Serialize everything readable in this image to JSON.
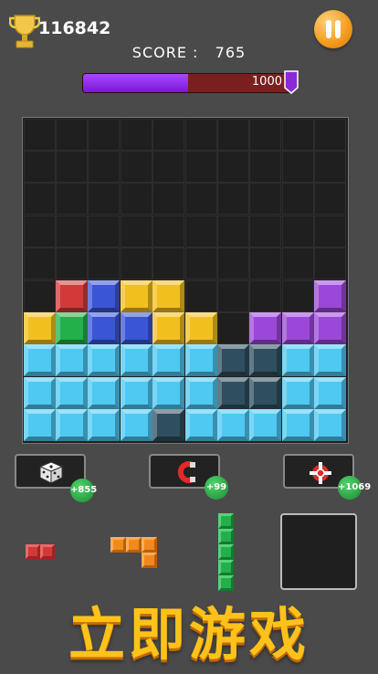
{
  "header": {
    "best_score": "116842",
    "score_label": "SCORE :   765",
    "target": "1000",
    "progress": 0.5
  },
  "colors": {
    "red": "#d23a3a",
    "blue": "#3a56d6",
    "yellow": "#f2c01e",
    "green": "#23b04a",
    "purple": "#9b48d8",
    "cyan": "#4fc8f2",
    "ghost": "#2f4f5f"
  },
  "board": {
    "cols": 10,
    "rows": 10,
    "cells": [
      "..........",
      "..........",
      "..........",
      "..........",
      "..........",
      ".RBYY....P",
      "YGBBYY.PPP",
      "CCCCCCggCC",
      "CCCCCCggCC",
      "CCCCgCCCCC"
    ]
  },
  "powerups": [
    {
      "name": "dice",
      "icon": "dice-icon",
      "badge": "+855"
    },
    {
      "name": "magnet",
      "icon": "magnet-icon",
      "badge": "+99"
    },
    {
      "name": "bomb",
      "icon": "bomb-icon",
      "badge": "+1069"
    }
  ],
  "pieces": [
    {
      "name": "red-piece",
      "color": "#d23a3a"
    },
    {
      "name": "orange-piece",
      "color": "#f08a1e"
    },
    {
      "name": "green-piece",
      "color": "#23b04a"
    }
  ],
  "footer": {
    "title": "立即游戏"
  }
}
